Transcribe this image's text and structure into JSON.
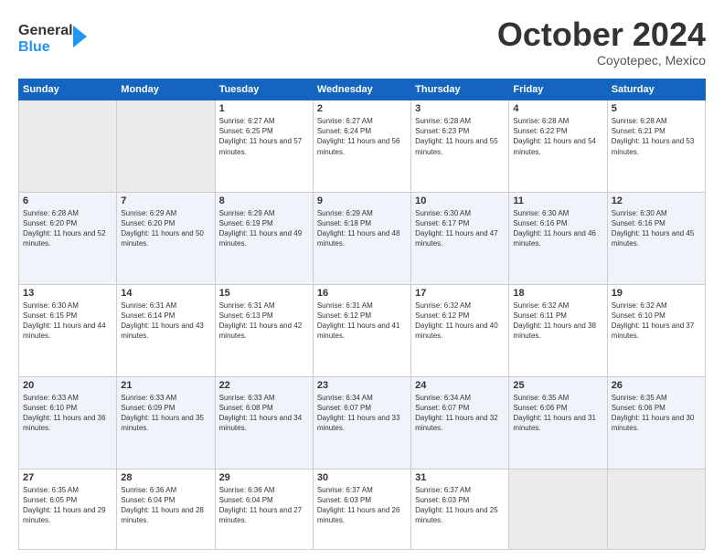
{
  "header": {
    "logo_line1": "General",
    "logo_line2": "Blue",
    "month": "October 2024",
    "location": "Coyotepec, Mexico"
  },
  "weekdays": [
    "Sunday",
    "Monday",
    "Tuesday",
    "Wednesday",
    "Thursday",
    "Friday",
    "Saturday"
  ],
  "weeks": [
    [
      {
        "day": "",
        "sunrise": "",
        "sunset": "",
        "daylight": ""
      },
      {
        "day": "",
        "sunrise": "",
        "sunset": "",
        "daylight": ""
      },
      {
        "day": "1",
        "sunrise": "Sunrise: 6:27 AM",
        "sunset": "Sunset: 6:25 PM",
        "daylight": "Daylight: 11 hours and 57 minutes."
      },
      {
        "day": "2",
        "sunrise": "Sunrise: 6:27 AM",
        "sunset": "Sunset: 6:24 PM",
        "daylight": "Daylight: 11 hours and 56 minutes."
      },
      {
        "day": "3",
        "sunrise": "Sunrise: 6:28 AM",
        "sunset": "Sunset: 6:23 PM",
        "daylight": "Daylight: 11 hours and 55 minutes."
      },
      {
        "day": "4",
        "sunrise": "Sunrise: 6:28 AM",
        "sunset": "Sunset: 6:22 PM",
        "daylight": "Daylight: 11 hours and 54 minutes."
      },
      {
        "day": "5",
        "sunrise": "Sunrise: 6:28 AM",
        "sunset": "Sunset: 6:21 PM",
        "daylight": "Daylight: 11 hours and 53 minutes."
      }
    ],
    [
      {
        "day": "6",
        "sunrise": "Sunrise: 6:28 AM",
        "sunset": "Sunset: 6:20 PM",
        "daylight": "Daylight: 11 hours and 52 minutes."
      },
      {
        "day": "7",
        "sunrise": "Sunrise: 6:29 AM",
        "sunset": "Sunset: 6:20 PM",
        "daylight": "Daylight: 11 hours and 50 minutes."
      },
      {
        "day": "8",
        "sunrise": "Sunrise: 6:29 AM",
        "sunset": "Sunset: 6:19 PM",
        "daylight": "Daylight: 11 hours and 49 minutes."
      },
      {
        "day": "9",
        "sunrise": "Sunrise: 6:29 AM",
        "sunset": "Sunset: 6:18 PM",
        "daylight": "Daylight: 11 hours and 48 minutes."
      },
      {
        "day": "10",
        "sunrise": "Sunrise: 6:30 AM",
        "sunset": "Sunset: 6:17 PM",
        "daylight": "Daylight: 11 hours and 47 minutes."
      },
      {
        "day": "11",
        "sunrise": "Sunrise: 6:30 AM",
        "sunset": "Sunset: 6:16 PM",
        "daylight": "Daylight: 11 hours and 46 minutes."
      },
      {
        "day": "12",
        "sunrise": "Sunrise: 6:30 AM",
        "sunset": "Sunset: 6:16 PM",
        "daylight": "Daylight: 11 hours and 45 minutes."
      }
    ],
    [
      {
        "day": "13",
        "sunrise": "Sunrise: 6:30 AM",
        "sunset": "Sunset: 6:15 PM",
        "daylight": "Daylight: 11 hours and 44 minutes."
      },
      {
        "day": "14",
        "sunrise": "Sunrise: 6:31 AM",
        "sunset": "Sunset: 6:14 PM",
        "daylight": "Daylight: 11 hours and 43 minutes."
      },
      {
        "day": "15",
        "sunrise": "Sunrise: 6:31 AM",
        "sunset": "Sunset: 6:13 PM",
        "daylight": "Daylight: 11 hours and 42 minutes."
      },
      {
        "day": "16",
        "sunrise": "Sunrise: 6:31 AM",
        "sunset": "Sunset: 6:12 PM",
        "daylight": "Daylight: 11 hours and 41 minutes."
      },
      {
        "day": "17",
        "sunrise": "Sunrise: 6:32 AM",
        "sunset": "Sunset: 6:12 PM",
        "daylight": "Daylight: 11 hours and 40 minutes."
      },
      {
        "day": "18",
        "sunrise": "Sunrise: 6:32 AM",
        "sunset": "Sunset: 6:11 PM",
        "daylight": "Daylight: 11 hours and 38 minutes."
      },
      {
        "day": "19",
        "sunrise": "Sunrise: 6:32 AM",
        "sunset": "Sunset: 6:10 PM",
        "daylight": "Daylight: 11 hours and 37 minutes."
      }
    ],
    [
      {
        "day": "20",
        "sunrise": "Sunrise: 6:33 AM",
        "sunset": "Sunset: 6:10 PM",
        "daylight": "Daylight: 11 hours and 36 minutes."
      },
      {
        "day": "21",
        "sunrise": "Sunrise: 6:33 AM",
        "sunset": "Sunset: 6:09 PM",
        "daylight": "Daylight: 11 hours and 35 minutes."
      },
      {
        "day": "22",
        "sunrise": "Sunrise: 6:33 AM",
        "sunset": "Sunset: 6:08 PM",
        "daylight": "Daylight: 11 hours and 34 minutes."
      },
      {
        "day": "23",
        "sunrise": "Sunrise: 6:34 AM",
        "sunset": "Sunset: 6:07 PM",
        "daylight": "Daylight: 11 hours and 33 minutes."
      },
      {
        "day": "24",
        "sunrise": "Sunrise: 6:34 AM",
        "sunset": "Sunset: 6:07 PM",
        "daylight": "Daylight: 11 hours and 32 minutes."
      },
      {
        "day": "25",
        "sunrise": "Sunrise: 6:35 AM",
        "sunset": "Sunset: 6:06 PM",
        "daylight": "Daylight: 11 hours and 31 minutes."
      },
      {
        "day": "26",
        "sunrise": "Sunrise: 6:35 AM",
        "sunset": "Sunset: 6:06 PM",
        "daylight": "Daylight: 11 hours and 30 minutes."
      }
    ],
    [
      {
        "day": "27",
        "sunrise": "Sunrise: 6:35 AM",
        "sunset": "Sunset: 6:05 PM",
        "daylight": "Daylight: 11 hours and 29 minutes."
      },
      {
        "day": "28",
        "sunrise": "Sunrise: 6:36 AM",
        "sunset": "Sunset: 6:04 PM",
        "daylight": "Daylight: 11 hours and 28 minutes."
      },
      {
        "day": "29",
        "sunrise": "Sunrise: 6:36 AM",
        "sunset": "Sunset: 6:04 PM",
        "daylight": "Daylight: 11 hours and 27 minutes."
      },
      {
        "day": "30",
        "sunrise": "Sunrise: 6:37 AM",
        "sunset": "Sunset: 6:03 PM",
        "daylight": "Daylight: 11 hours and 26 minutes."
      },
      {
        "day": "31",
        "sunrise": "Sunrise: 6:37 AM",
        "sunset": "Sunset: 6:03 PM",
        "daylight": "Daylight: 11 hours and 25 minutes."
      },
      {
        "day": "",
        "sunrise": "",
        "sunset": "",
        "daylight": ""
      },
      {
        "day": "",
        "sunrise": "",
        "sunset": "",
        "daylight": ""
      }
    ]
  ]
}
